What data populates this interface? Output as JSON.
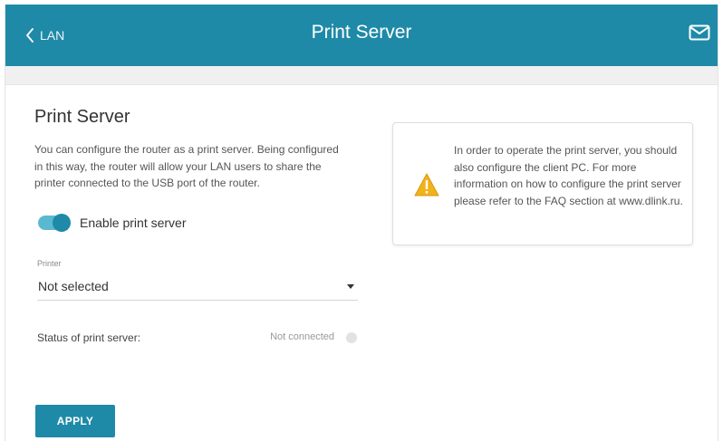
{
  "header": {
    "back_label": "LAN",
    "title": "Print Server",
    "mail_icon": "mail-icon"
  },
  "section": {
    "title": "Print Server",
    "description": "You can configure the router as a print server. Being configured in this way, the router will allow your LAN users to share the printer connected to the USB port of the router."
  },
  "toggle": {
    "label": "Enable print server",
    "enabled": true
  },
  "printer": {
    "label": "Printer",
    "value": "Not selected"
  },
  "status": {
    "label": "Status of print server:",
    "value": "Not connected"
  },
  "apply_label": "APPLY",
  "info": {
    "text": "In order to operate the print server, you should also configure the client PC. For more information on how to configure the print server please refer to the FAQ section at www.dlink.ru.",
    "icon": "warning-icon"
  },
  "colors": {
    "accent": "#1e8aa8",
    "warning": "#f2b21b"
  }
}
